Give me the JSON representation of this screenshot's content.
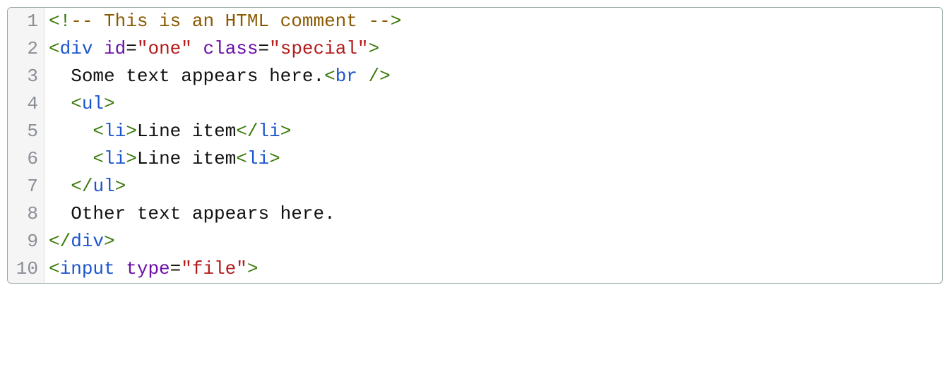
{
  "code": {
    "lines": [
      {
        "num": "1"
      },
      {
        "num": "2"
      },
      {
        "num": "3"
      },
      {
        "num": "4"
      },
      {
        "num": "5"
      },
      {
        "num": "6"
      },
      {
        "num": "7"
      },
      {
        "num": "8"
      },
      {
        "num": "9"
      },
      {
        "num": "10"
      }
    ],
    "l1": {
      "open": "<!",
      "body": "-- This is an HTML comment --",
      "close": ">"
    },
    "l2": {
      "lt": "<",
      "tag": "div",
      "sp1": " ",
      "attr1": "id",
      "eq1": "=",
      "val1": "\"one\"",
      "sp2": " ",
      "attr2": "class",
      "eq2": "=",
      "val2": "\"special\"",
      "gt": ">"
    },
    "l3": {
      "indent": "  ",
      "text": "Some text appears here.",
      "br_lt": "<",
      "br_tag": "br",
      "br_sp": " ",
      "br_slash": "/",
      "br_gt": ">"
    },
    "l4": {
      "indent": "  ",
      "lt": "<",
      "tag": "ul",
      "gt": ">"
    },
    "l5": {
      "indent": "    ",
      "lt1": "<",
      "tag1": "li",
      "gt1": ">",
      "text": "Line item",
      "lt2": "<",
      "slash": "/",
      "tag2": "li",
      "gt2": ">"
    },
    "l6": {
      "indent": "    ",
      "lt1": "<",
      "tag1": "li",
      "gt1": ">",
      "text": "Line item",
      "lt2": "<",
      "tag2": "li",
      "gt2": ">"
    },
    "l7": {
      "indent": "  ",
      "lt": "<",
      "slash": "/",
      "tag": "ul",
      "gt": ">"
    },
    "l8": {
      "indent": "  ",
      "text": "Other text appears here."
    },
    "l9": {
      "lt": "<",
      "slash": "/",
      "tag": "div",
      "gt": ">"
    },
    "l10": {
      "lt": "<",
      "tag": "input",
      "sp": " ",
      "attr": "type",
      "eq": "=",
      "val": "\"file\"",
      "gt": ">"
    }
  }
}
